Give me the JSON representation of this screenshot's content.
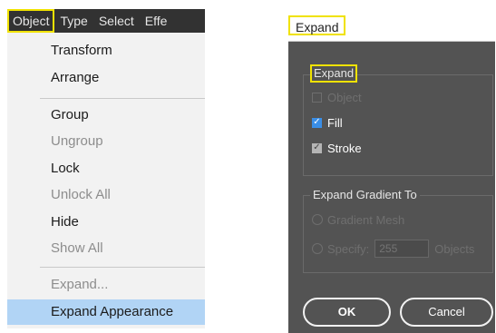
{
  "menubar": {
    "items": [
      "Object",
      "Type",
      "Select",
      "Effe"
    ]
  },
  "object_menu": {
    "items": [
      {
        "label": "Transform",
        "disabled": false
      },
      {
        "label": "Arrange",
        "disabled": false
      },
      {
        "label": "Group",
        "disabled": false
      },
      {
        "label": "Ungroup",
        "disabled": true
      },
      {
        "label": "Lock",
        "disabled": false
      },
      {
        "label": "Unlock All",
        "disabled": true
      },
      {
        "label": "Hide",
        "disabled": false
      },
      {
        "label": "Show All",
        "disabled": true
      },
      {
        "label": "Expand...",
        "disabled": true
      },
      {
        "label": "Expand Appearance",
        "disabled": false,
        "highlighted": true
      }
    ]
  },
  "dialog": {
    "title": "Expand",
    "expand_group": {
      "title": "Expand",
      "options": [
        {
          "label": "Object",
          "checked": false,
          "enabled": false
        },
        {
          "label": "Fill",
          "checked": true,
          "enabled": true
        },
        {
          "label": "Stroke",
          "checked": true,
          "enabled": true
        }
      ]
    },
    "gradient_group": {
      "title": "Expand Gradient To",
      "gradient_mesh_label": "Gradient Mesh",
      "specify_label": "Specify:",
      "specify_value": "255",
      "objects_label": "Objects"
    },
    "buttons": {
      "ok": "OK",
      "cancel": "Cancel"
    }
  },
  "colors": {
    "menubar": "#323232",
    "menu_bg": "#f2f2f2",
    "menu_highlight": "#b1d4f5",
    "dialog_bg": "#535353",
    "annotation_yellow": "#f0e200",
    "checkbox_blue": "#3a8ee6"
  },
  "icons": {
    "checkbox_checked": "checkmark-icon"
  }
}
